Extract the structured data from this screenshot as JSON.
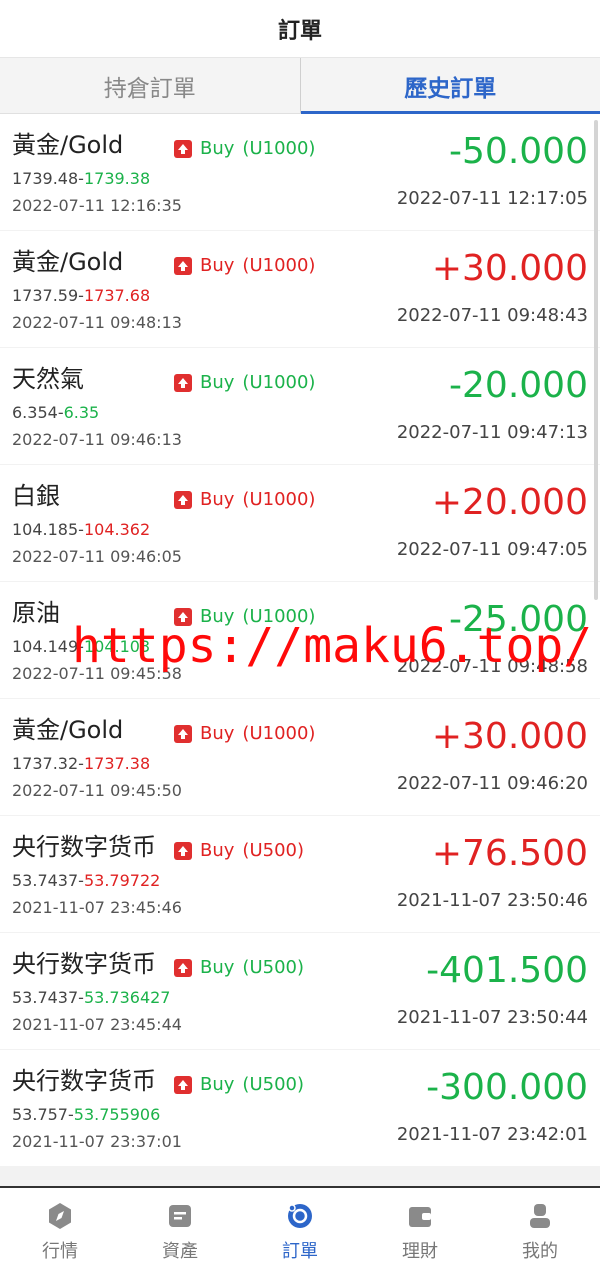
{
  "header": {
    "title": "訂單"
  },
  "tabs": [
    {
      "label": "持倉訂單",
      "active": false
    },
    {
      "label": "歷史訂單",
      "active": true
    }
  ],
  "orders": [
    {
      "name": "黃金/Gold",
      "direction": "Buy",
      "amount": "(U1000)",
      "open_price": "1739.48",
      "close_price": "1739.38",
      "open_time": "2022-07-11 12:16:35",
      "pnl": "-50.000",
      "close_time": "2022-07-11 12:17:05",
      "profit": false
    },
    {
      "name": "黃金/Gold",
      "direction": "Buy",
      "amount": "(U1000)",
      "open_price": "1737.59",
      "close_price": "1737.68",
      "open_time": "2022-07-11 09:48:13",
      "pnl": "+30.000",
      "close_time": "2022-07-11 09:48:43",
      "profit": true
    },
    {
      "name": "天然氣",
      "direction": "Buy",
      "amount": "(U1000)",
      "open_price": "6.354",
      "close_price": "6.35",
      "open_time": "2022-07-11 09:46:13",
      "pnl": "-20.000",
      "close_time": "2022-07-11 09:47:13",
      "profit": false
    },
    {
      "name": "白銀",
      "direction": "Buy",
      "amount": "(U1000)",
      "open_price": "104.185",
      "close_price": "104.362",
      "open_time": "2022-07-11 09:46:05",
      "pnl": "+20.000",
      "close_time": "2022-07-11 09:47:05",
      "profit": true
    },
    {
      "name": "原油",
      "direction": "Buy",
      "amount": "(U1000)",
      "open_price": "104.149",
      "close_price": "104.103",
      "open_time": "2022-07-11 09:45:58",
      "pnl": "-25.000",
      "close_time": "2022-07-11 09:48:58",
      "profit": false
    },
    {
      "name": "黃金/Gold",
      "direction": "Buy",
      "amount": "(U1000)",
      "open_price": "1737.32",
      "close_price": "1737.38",
      "open_time": "2022-07-11 09:45:50",
      "pnl": "+30.000",
      "close_time": "2022-07-11 09:46:20",
      "profit": true
    },
    {
      "name": "央行数字货币",
      "direction": "Buy",
      "amount": "(U500)",
      "open_price": "53.7437",
      "close_price": "53.79722",
      "open_time": "2021-11-07 23:45:46",
      "pnl": "+76.500",
      "close_time": "2021-11-07 23:50:46",
      "profit": true
    },
    {
      "name": "央行数字货币",
      "direction": "Buy",
      "amount": "(U500)",
      "open_price": "53.7437",
      "close_price": "53.736427",
      "open_time": "2021-11-07 23:45:44",
      "pnl": "-401.500",
      "close_time": "2021-11-07 23:50:44",
      "profit": false
    },
    {
      "name": "央行数字货币",
      "direction": "Buy",
      "amount": "(U500)",
      "open_price": "53.757",
      "close_price": "53.755906",
      "open_time": "2021-11-07 23:37:01",
      "pnl": "-300.000",
      "close_time": "2021-11-07 23:42:01",
      "profit": false
    }
  ],
  "watermark": "https://maku6.top/",
  "nav": [
    {
      "label": "行情",
      "icon": "compass-icon",
      "active": false
    },
    {
      "label": "資產",
      "icon": "wallet-card-icon",
      "active": false
    },
    {
      "label": "訂單",
      "icon": "orders-icon",
      "active": true
    },
    {
      "label": "理財",
      "icon": "purse-icon",
      "active": false
    },
    {
      "label": "我的",
      "icon": "user-icon",
      "active": false
    }
  ],
  "colors": {
    "accent": "#2d66c9",
    "profit": "#e02222",
    "loss": "#1bb24a",
    "buy_badge": "#e02f2f"
  }
}
